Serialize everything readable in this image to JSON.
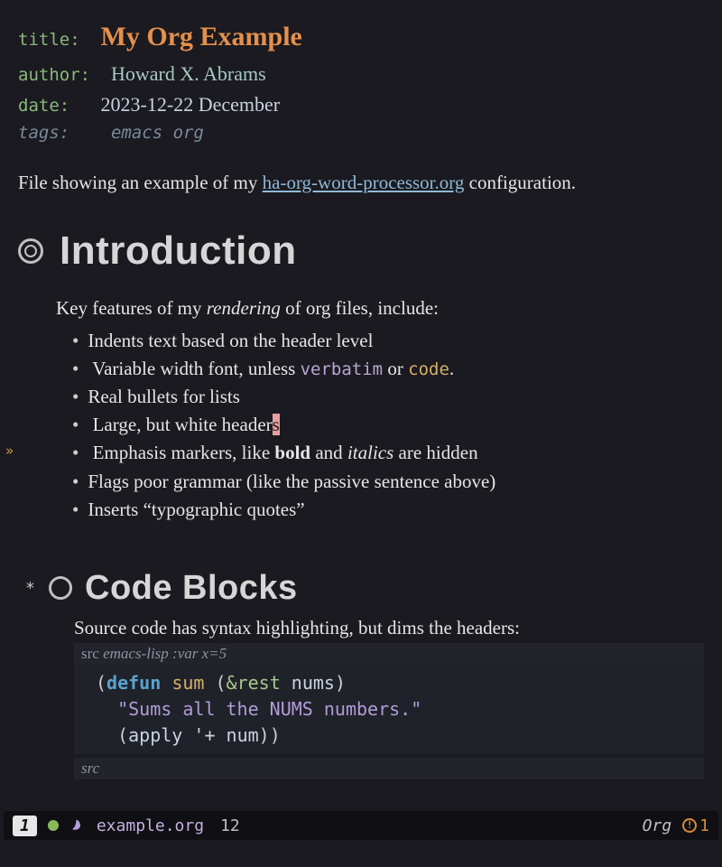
{
  "meta": {
    "title_key": "title",
    "title_val": "My Org Example",
    "author_key": "author",
    "author_val": "Howard X. Abrams",
    "date_key": "date",
    "date_val": "2023-12-22 December",
    "tags_key": "tags:",
    "tags_val": "emacs org"
  },
  "intro": {
    "pre": "File showing an example of my ",
    "link": "ha-org-word-processor.org",
    "post": " configuration."
  },
  "sections": {
    "intro_heading": "Introduction",
    "intro_lead_pre": "Key features of my ",
    "intro_lead_em": "rendering",
    "intro_lead_post": " of org files, include:",
    "bullets": {
      "b0": "Indents text based on the header level",
      "b1_pre": "Variable width font, unless ",
      "b1_verb": "verbatim",
      "b1_mid": " or ",
      "b1_code": "code",
      "b1_post": ".",
      "b2": "Real bullets for lists",
      "b3_pre": "Large, but white header",
      "b3_cursor": "s",
      "b4_pre": "Emphasis markers, like ",
      "b4_bold": "bold",
      "b4_mid": " and ",
      "b4_it": "italics",
      "b4_post": " are hidden",
      "b5": "Flags poor grammar (like the passive sentence above)",
      "b6": "Inserts “typographic quotes”"
    },
    "code_heading": "Code Blocks",
    "code_heading_star": "*",
    "code_lead": "Source code has syntax highlighting, but dims the headers:",
    "src_header_kw": "src",
    "src_header_rest": " emacs-lisp :var x=5",
    "src_footer": "src",
    "code": {
      "l1_open": "(",
      "l1_defun": "defun",
      "l1_sp1": " ",
      "l1_name": "sum",
      "l1_sp2": " ",
      "l1_open2": "(",
      "l1_amp": "&rest",
      "l1_sp3": " ",
      "l1_arg": "nums",
      "l1_close": ")",
      "l2_doc": "\"Sums all the NUMS numbers.\"",
      "l3_open": "(",
      "l3_apply": "apply",
      "l3_sp": " ",
      "l3_q": "'",
      "l3_plus": "+",
      "l3_sp2": " ",
      "l3_num": "num",
      "l3_close": "))"
    }
  },
  "modeline": {
    "winnum": "1",
    "filename": "example.org",
    "line": "12",
    "mode": "Org",
    "warn_count": "1",
    "warn_mark": "!"
  },
  "fringe_arrow": "»"
}
